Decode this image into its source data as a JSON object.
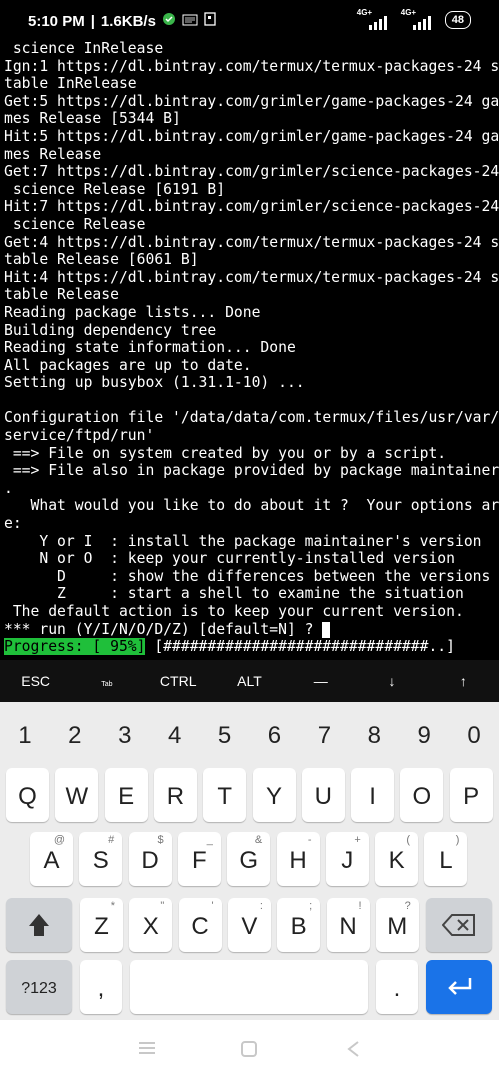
{
  "status_bar": {
    "time": "5:10 PM",
    "speed": "1.6KB/s",
    "net1": "4G+",
    "net2": "4G+",
    "battery": "48"
  },
  "terminal": {
    "lines": [
      " science InRelease",
      "Ign:1 https://dl.bintray.com/termux/termux-packages-24 s",
      "table InRelease",
      "Get:5 https://dl.bintray.com/grimler/game-packages-24 ga",
      "mes Release [5344 B]",
      "Hit:5 https://dl.bintray.com/grimler/game-packages-24 ga",
      "mes Release",
      "Get:7 https://dl.bintray.com/grimler/science-packages-24",
      " science Release [6191 B]",
      "Hit:7 https://dl.bintray.com/grimler/science-packages-24",
      " science Release",
      "Get:4 https://dl.bintray.com/termux/termux-packages-24 s",
      "table Release [6061 B]",
      "Hit:4 https://dl.bintray.com/termux/termux-packages-24 s",
      "table Release",
      "Reading package lists... Done",
      "Building dependency tree",
      "Reading state information... Done",
      "All packages are up to date.",
      "Setting up busybox (1.31.1-10) ...",
      "",
      "Configuration file '/data/data/com.termux/files/usr/var/",
      "service/ftpd/run'",
      " ==> File on system created by you or by a script.",
      " ==> File also in package provided by package maintainer",
      ".",
      "   What would you like to do about it ?  Your options ar",
      "e:",
      "    Y or I  : install the package maintainer's version",
      "    N or O  : keep your currently-installed version",
      "      D     : show the differences between the versions",
      "      Z     : start a shell to examine the situation",
      " The default action is to keep your current version."
    ],
    "prompt": "*** run (Y/I/N/O/D/Z) [default=N] ? ",
    "progress_label": "Progress: [ 95%]",
    "progress_bar": " [##############################..]"
  },
  "extra_keys": [
    "ESC",
    "Tab",
    "CTRL",
    "ALT",
    "—",
    "↓",
    "↑"
  ],
  "keyboard": {
    "numbers": [
      "1",
      "2",
      "3",
      "4",
      "5",
      "6",
      "7",
      "8",
      "9",
      "0"
    ],
    "row1": [
      "Q",
      "W",
      "E",
      "R",
      "T",
      "Y",
      "U",
      "I",
      "O",
      "P"
    ],
    "row2": [
      [
        "A",
        "@"
      ],
      [
        "S",
        "#"
      ],
      [
        "D",
        "$"
      ],
      [
        "F",
        "_"
      ],
      [
        "G",
        "&"
      ],
      [
        "H",
        "-"
      ],
      [
        "J",
        "+"
      ],
      [
        "K",
        "("
      ],
      [
        "L",
        ")"
      ]
    ],
    "row3": [
      [
        "Z",
        "*"
      ],
      [
        "X",
        "\""
      ],
      [
        "C",
        "'"
      ],
      [
        "V",
        ":"
      ],
      [
        "B",
        ";"
      ],
      [
        "N",
        "!"
      ],
      [
        "M",
        "?"
      ]
    ],
    "sym_label": "?123",
    "comma": ",",
    "period": "."
  },
  "colors": {
    "progress_green": "#1fbf3a",
    "enter_blue": "#1a73e8",
    "keyboard_bg": "#ececec"
  }
}
